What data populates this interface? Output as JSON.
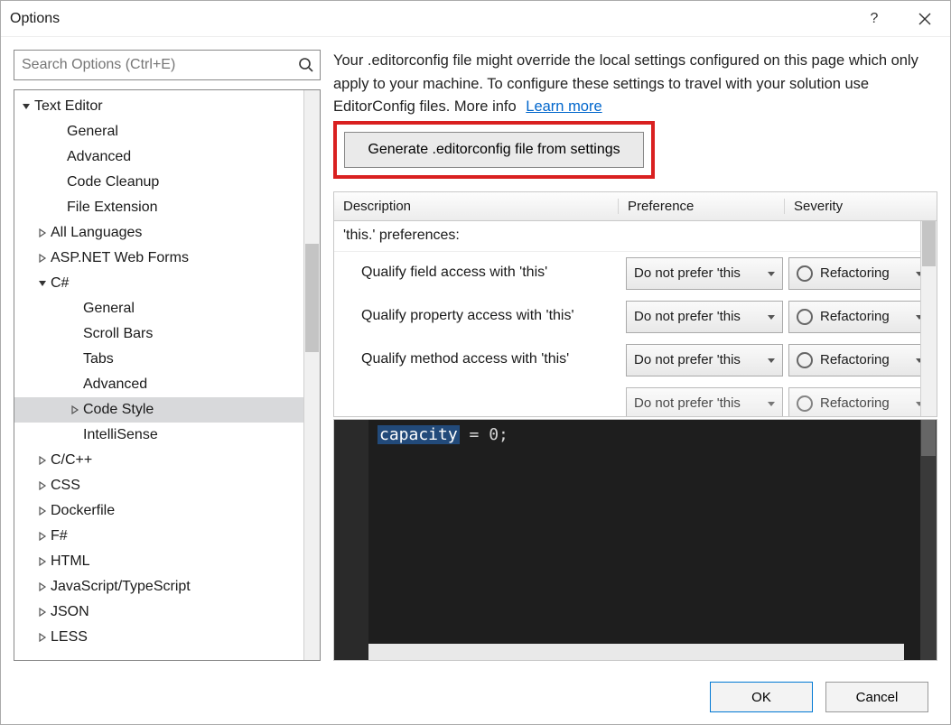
{
  "window": {
    "title": "Options"
  },
  "search": {
    "placeholder": "Search Options (Ctrl+E)"
  },
  "tree": [
    {
      "label": "Text Editor",
      "indent": 0,
      "arrow": "down"
    },
    {
      "label": "General",
      "indent": 2,
      "arrow": ""
    },
    {
      "label": "Advanced",
      "indent": 2,
      "arrow": ""
    },
    {
      "label": "Code Cleanup",
      "indent": 2,
      "arrow": ""
    },
    {
      "label": "File Extension",
      "indent": 2,
      "arrow": ""
    },
    {
      "label": "All Languages",
      "indent": 1,
      "arrow": "right"
    },
    {
      "label": "ASP.NET Web Forms",
      "indent": 1,
      "arrow": "right"
    },
    {
      "label": "C#",
      "indent": 1,
      "arrow": "down"
    },
    {
      "label": "General",
      "indent": 3,
      "arrow": ""
    },
    {
      "label": "Scroll Bars",
      "indent": 3,
      "arrow": ""
    },
    {
      "label": "Tabs",
      "indent": 3,
      "arrow": ""
    },
    {
      "label": "Advanced",
      "indent": 3,
      "arrow": ""
    },
    {
      "label": "Code Style",
      "indent": 3,
      "arrow": "right",
      "selected": true
    },
    {
      "label": "IntelliSense",
      "indent": 3,
      "arrow": ""
    },
    {
      "label": "C/C++",
      "indent": 1,
      "arrow": "right"
    },
    {
      "label": "CSS",
      "indent": 1,
      "arrow": "right"
    },
    {
      "label": "Dockerfile",
      "indent": 1,
      "arrow": "right"
    },
    {
      "label": "F#",
      "indent": 1,
      "arrow": "right"
    },
    {
      "label": "HTML",
      "indent": 1,
      "arrow": "right"
    },
    {
      "label": "JavaScript/TypeScript",
      "indent": 1,
      "arrow": "right"
    },
    {
      "label": "JSON",
      "indent": 1,
      "arrow": "right"
    },
    {
      "label": "LESS",
      "indent": 1,
      "arrow": "right"
    }
  ],
  "notice": {
    "text": "Your .editorconfig file might override the local settings configured on this page which only apply to your machine. To configure these settings to travel with your solution use EditorConfig files. More info",
    "link": "Learn more"
  },
  "generate_button": "Generate .editorconfig file from settings",
  "grid": {
    "columns": {
      "desc": "Description",
      "pref": "Preference",
      "sev": "Severity"
    },
    "group": "'this.' preferences:",
    "rows": [
      {
        "desc": "Qualify field access with 'this'",
        "pref": "Do not prefer 'this",
        "sev": "Refactoring"
      },
      {
        "desc": "Qualify property access with 'this'",
        "pref": "Do not prefer 'this",
        "sev": "Refactoring"
      },
      {
        "desc": "Qualify method access with 'this'",
        "pref": "Do not prefer 'this",
        "sev": "Refactoring"
      },
      {
        "desc": "",
        "pref": "Do not prefer 'this",
        "sev": "Refactoring"
      }
    ]
  },
  "code": {
    "word": "capacity",
    "rest": " = 0;"
  },
  "footer": {
    "ok": "OK",
    "cancel": "Cancel"
  }
}
